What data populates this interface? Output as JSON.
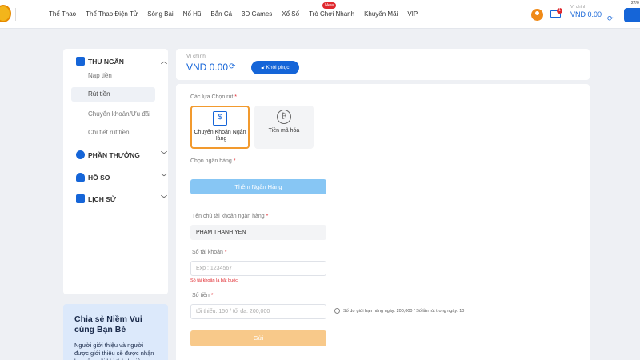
{
  "nav": {
    "items": [
      "Thể Thao",
      "Thể Thao Điện Tử",
      "Sòng Bài",
      "Nổ Hũ",
      "Bắn Cá",
      "3D Games",
      "Xổ Số",
      "Trò Chơi Nhanh",
      "Khuyến Mãi",
      "VIP"
    ],
    "new_badge": "New"
  },
  "header": {
    "mail_count": "1",
    "wallet_label": "Ví chính",
    "wallet_value": "VND 0.00",
    "date": "27/0"
  },
  "sidebar": {
    "cashier": "THU NGÂN",
    "deposit": "Nạp tiền",
    "withdraw": "Rút tiền",
    "transfer": "Chuyển khoản/Ưu đãi",
    "withdraw_detail": "Chi tiết rút tiền",
    "rewards": "PHẦN THƯỞNG",
    "profile": "HỒ SƠ",
    "history": "LỊCH SỬ"
  },
  "promo": {
    "title": "Chia sẻ Niềm Vui cùng Bạn Bè",
    "desc": "Người giới thiệu và người được giới thiệu sẽ được nhận khuyến mãi khi thành viên"
  },
  "balance": {
    "label": "Ví chính",
    "value": "VND 0.00",
    "restore": "Khôi phục"
  },
  "form": {
    "options_label": "Các lựa Chọn rút",
    "opt_bank": "Chuyển Khoản Ngân Hàng",
    "opt_crypto": "Tiền mã hóa",
    "bank_select_label": "Chọn ngân hàng",
    "add_bank": "Thêm Ngân Hàng",
    "holder_label": "Tên chủ tài khoản ngân hàng",
    "holder_value": "PHAM THANH YEN",
    "account_label": "Số tài khoản",
    "account_placeholder": "Exp : 1234567",
    "account_error": "Số tài khoản là bắt buộc",
    "amount_label": "Số tiền",
    "amount_placeholder": "tối thiểu: 150 / tối đa: 200,000",
    "amount_note": "Số dư giới hạn hàng ngày: 200,000 / Số lần rút trong ngày: 10",
    "submit": "Gửi"
  }
}
